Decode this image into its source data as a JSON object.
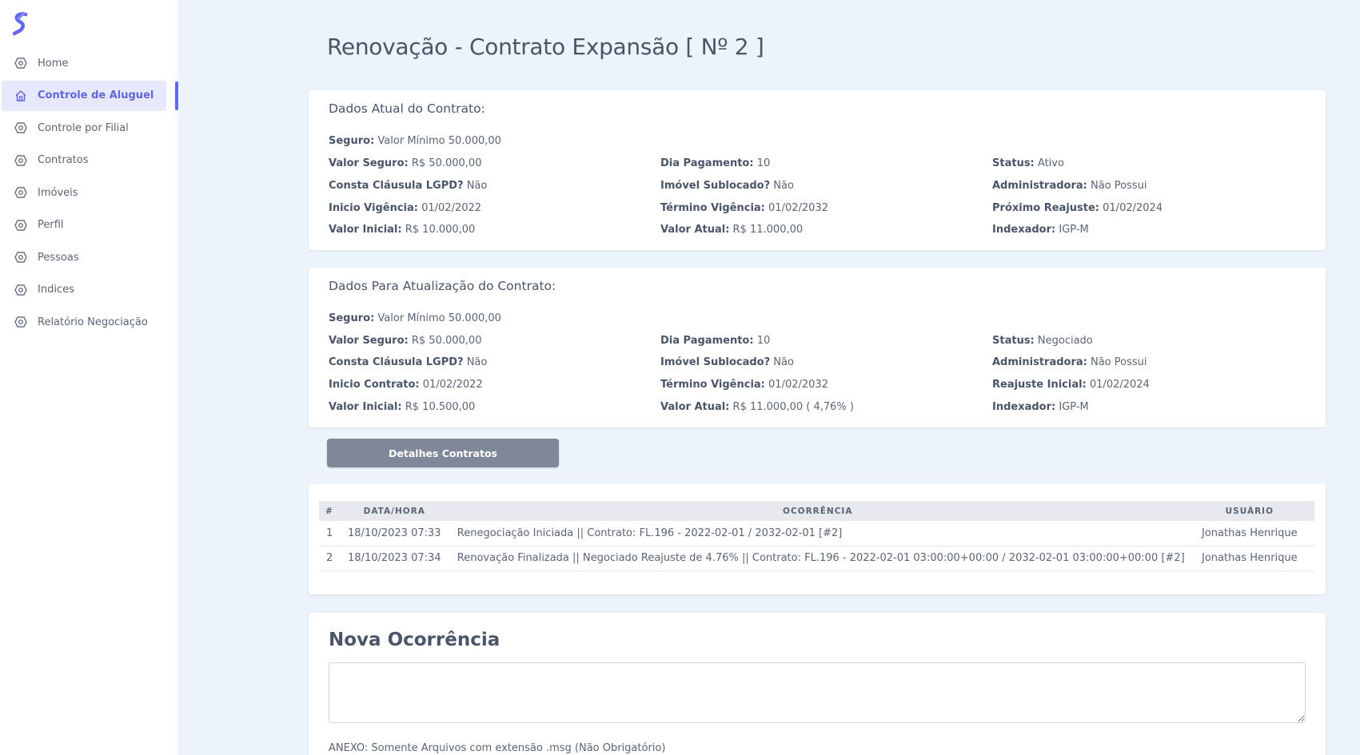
{
  "sidebar": {
    "logo_icon": "logo-s-icon",
    "accent": "#6366f1",
    "items": [
      {
        "label": "Home",
        "icon": "hexagon-icon"
      },
      {
        "label": "Controle de Aluguel",
        "icon": "home-icon",
        "active": true
      },
      {
        "label": "Controle por Filial",
        "icon": "hexagon-icon"
      },
      {
        "label": "Contratos",
        "icon": "hexagon-icon"
      },
      {
        "label": "Imóveis",
        "icon": "hexagon-icon"
      },
      {
        "label": "Perfil",
        "icon": "hexagon-icon"
      },
      {
        "label": "Pessoas",
        "icon": "hexagon-icon"
      },
      {
        "label": "Indices",
        "icon": "hexagon-icon"
      },
      {
        "label": "Relatório Negociação",
        "icon": "hexagon-icon"
      }
    ]
  },
  "page": {
    "title": "Renovação - Contrato Expansão [ Nº 2 ]"
  },
  "atual": {
    "title": "Dados Atual do Contrato:",
    "seguro_label": "Seguro:",
    "seguro_value": "Valor Mínimo 50.000,00",
    "valor_seguro_label": "Valor Seguro:",
    "valor_seguro_value": "R$ 50.000,00",
    "dia_pagamento_label": "Dia Pagamento:",
    "dia_pagamento_value": "10",
    "status_label": "Status:",
    "status_value": "Ativo",
    "lgpd_label": "Consta Cláusula LGPD?",
    "lgpd_value": "Não",
    "sublocado_label": "Imóvel Sublocado?",
    "sublocado_value": "Não",
    "administradora_label": "Administradora:",
    "administradora_value": "Não Possui",
    "inicio_label": "Inicio Vigência:",
    "inicio_value": "01/02/2022",
    "termino_label": "Término Vigência:",
    "termino_value": "01/02/2032",
    "reajuste_label": "Próximo Reajuste:",
    "reajuste_value": "01/02/2024",
    "valor_inicial_label": "Valor Inicial:",
    "valor_inicial_value": "R$ 10.000,00",
    "valor_atual_label": "Valor Atual:",
    "valor_atual_value": "R$ 11.000,00",
    "indexador_label": "Indexador:",
    "indexador_value": "IGP-M"
  },
  "atualizacao": {
    "title": "Dados Para Atualização do Contrato:",
    "seguro_label": "Seguro:",
    "seguro_value": "Valor Mínimo 50.000,00",
    "valor_seguro_label": "Valor Seguro:",
    "valor_seguro_value": "R$ 50.000,00",
    "dia_pagamento_label": "Dia Pagamento:",
    "dia_pagamento_value": "10",
    "status_label": "Status:",
    "status_value": "Negociado",
    "lgpd_label": "Consta Cláusula LGPD?",
    "lgpd_value": "Não",
    "sublocado_label": "Imóvel Sublocado?",
    "sublocado_value": "Não",
    "administradora_label": "Administradora:",
    "administradora_value": "Não Possui",
    "inicio_label": "Inicio Contrato:",
    "inicio_value": "01/02/2022",
    "termino_label": "Término Vigência:",
    "termino_value": "01/02/2032",
    "reajuste_label": "Reajuste Inicial:",
    "reajuste_value": "01/02/2024",
    "valor_inicial_label": "Valor Inicial:",
    "valor_inicial_value": "R$ 10.500,00",
    "valor_atual_label": "Valor Atual:",
    "valor_atual_value": "R$ 11.000,00 ( 4,76% )",
    "indexador_label": "Indexador:",
    "indexador_value": "IGP-M"
  },
  "detalhes_button": "Detalhes Contratos",
  "ocorrencias": {
    "headers": [
      "#",
      "DATA/HORA",
      "OCORRÊNCIA",
      "USUÁRIO"
    ],
    "rows": [
      [
        "1",
        "18/10/2023 07:33",
        "Renegociação Iniciada || Contrato: FL.196 - 2022-02-01 / 2032-02-01 [#2]",
        "Jonathas Henrique"
      ],
      [
        "2",
        "18/10/2023 07:34",
        "Renovação Finalizada || Negociado Reajuste de 4.76% || Contrato: FL.196 - 2022-02-01 03:00:00+00:00 / 2032-02-01 03:00:00+00:00 [#2]",
        "Jonathas Henrique"
      ]
    ]
  },
  "nova": {
    "title": "Nova Ocorrência",
    "textarea_value": "",
    "anexo_label": "ANEXO: Somente Arquivos com extensão .msg (Não Obrigatório)"
  }
}
